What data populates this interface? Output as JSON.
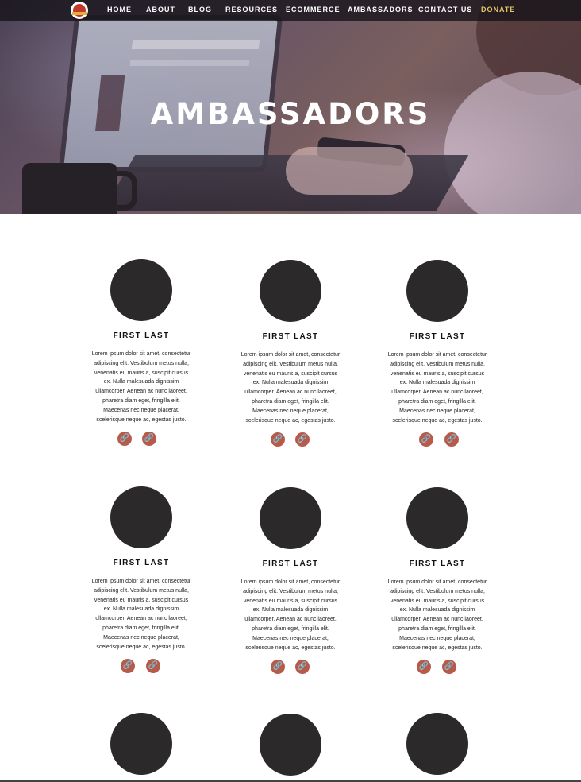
{
  "nav": {
    "items": [
      "HOME",
      "ABOUT",
      "BLOG",
      "RESOURCES",
      "ECOMMERCE",
      "AMBASSADORS",
      "CONTACT US"
    ],
    "donate": "DONATE",
    "donate_color": "#e8c46b"
  },
  "hero": {
    "title": "AMBASSADORS"
  },
  "ambassadors": [
    {
      "name": "FIRST LAST",
      "bio": "Lorem ipsum dolor sit amet, consectetur adipiscing elit. Vestibulum metus nulla, venenatis eu mauris a, suscipit cursus ex. Nulla malesuada dignissim ullamcorper. Aenean ac nunc laoreet, pharetra diam eget, fringilla elit. Maecenas nec neque placerat, scelerisque neque ac, egestas justo."
    },
    {
      "name": "FIRST LAST",
      "bio": "Lorem ipsum dolor sit amet, consectetur adipiscing elit. Vestibulum metus nulla, venenatis eu mauris a, suscipit cursus ex. Nulla malesuada dignissim ullamcorper. Aenean ac nunc laoreet, pharetra diam eget, fringilla elit. Maecenas nec neque placerat, scelerisque neque ac, egestas justo."
    },
    {
      "name": "FIRST LAST",
      "bio": "Lorem ipsum dolor sit amet, consectetur adipiscing elit. Vestibulum metus nulla, venenatis eu mauris a, suscipit cursus ex. Nulla malesuada dignissim ullamcorper. Aenean ac nunc laoreet, pharetra diam eget, fringilla elit. Maecenas nec neque placerat, scelerisque neque ac, egestas justo."
    },
    {
      "name": "FIRST LAST",
      "bio": "Lorem ipsum dolor sit amet, consectetur adipiscing elit. Vestibulum metus nulla, venenatis eu mauris a, suscipit cursus ex. Nulla malesuada dignissim ullamcorper. Aenean ac nunc laoreet, pharetra diam eget, fringilla elit. Maecenas nec neque placerat, scelerisque neque ac, egestas justo."
    },
    {
      "name": "FIRST LAST",
      "bio": "Lorem ipsum dolor sit amet, consectetur adipiscing elit. Vestibulum metus nulla, venenatis eu mauris a, suscipit cursus ex. Nulla malesuada dignissim ullamcorper. Aenean ac nunc laoreet, pharetra diam eget, fringilla elit. Maecenas nec neque placerat, scelerisque neque ac, egestas justo."
    },
    {
      "name": "FIRST LAST",
      "bio": "Lorem ipsum dolor sit amet, consectetur adipiscing elit. Vestibulum metus nulla, venenatis eu mauris a, suscipit cursus ex. Nulla malesuada dignissim ullamcorper. Aenean ac nunc laoreet, pharetra diam eget, fringilla elit. Maecenas nec neque placerat, scelerisque neque ac, egestas justo."
    }
  ],
  "link_icon": "link-icon",
  "link_glyph": "🔗",
  "link_color": "#b85a4a"
}
